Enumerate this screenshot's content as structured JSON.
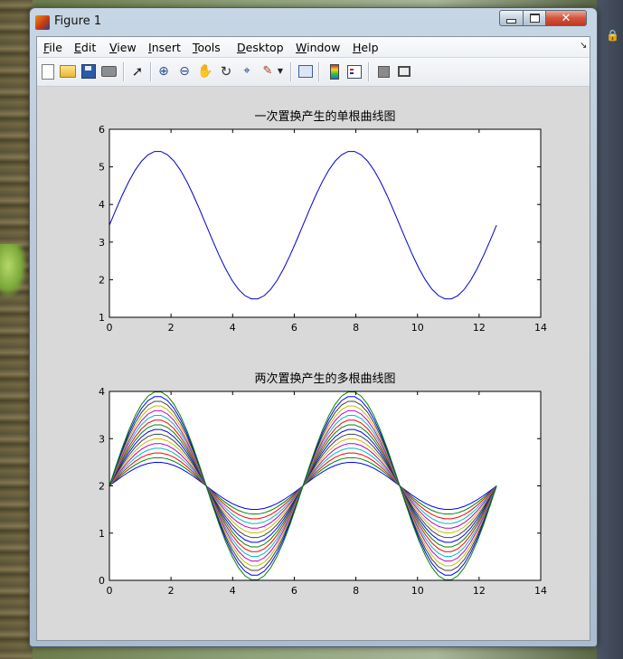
{
  "window": {
    "title": "Figure 1",
    "close_glyph": "✕"
  },
  "menu": {
    "items": [
      "File",
      "Edit",
      "View",
      "Insert",
      "Tools",
      "Desktop",
      "Window",
      "Help"
    ],
    "arrow_glyph": "↘"
  },
  "toolbar": {
    "icons": [
      "new-figure-icon",
      "open-file-icon",
      "save-icon",
      "print-icon",
      "edit-plot-arrow-icon",
      "zoom-in-icon",
      "zoom-out-icon",
      "pan-hand-icon",
      "rotate-3d-icon",
      "data-cursor-icon",
      "brush-icon",
      "brush-dropdown-icon",
      "link-plot-icon",
      "colorbar-icon",
      "legend-icon",
      "hide-plot-tools-icon",
      "show-plot-tools-icon"
    ]
  },
  "desktop": {
    "lock_glyph": "🔒"
  },
  "chart_data": [
    {
      "type": "line",
      "title": "一次置换产生的单根曲线图",
      "xlim": [
        0,
        14
      ],
      "ylim": [
        1,
        6
      ],
      "xticks": [
        0,
        2,
        4,
        6,
        8,
        10,
        12,
        14
      ],
      "yticks": [
        1,
        2,
        3,
        4,
        5,
        6
      ],
      "series": [
        {
          "color": "#0000cc",
          "x_range": [
            0,
            12.566
          ],
          "center": 3.45,
          "amplitude": 1.97
        }
      ]
    },
    {
      "type": "line",
      "title": "两次置换产生的多根曲线图",
      "xlim": [
        0,
        14
      ],
      "ylim": [
        0,
        4
      ],
      "xticks": [
        0,
        2,
        4,
        6,
        8,
        10,
        12,
        14
      ],
      "yticks": [
        0,
        1,
        2,
        3,
        4
      ],
      "series": [
        {
          "color": "#0000ff",
          "x_range": [
            0,
            12.566
          ],
          "center": 2,
          "amplitude": 0.5
        },
        {
          "color": "#008000",
          "x_range": [
            0,
            12.566
          ],
          "center": 2,
          "amplitude": 0.6
        },
        {
          "color": "#ff0000",
          "x_range": [
            0,
            12.566
          ],
          "center": 2,
          "amplitude": 0.7
        },
        {
          "color": "#00bfbf",
          "x_range": [
            0,
            12.566
          ],
          "center": 2,
          "amplitude": 0.8
        },
        {
          "color": "#bf00bf",
          "x_range": [
            0,
            12.566
          ],
          "center": 2,
          "amplitude": 0.9
        },
        {
          "color": "#bfbf00",
          "x_range": [
            0,
            12.566
          ],
          "center": 2,
          "amplitude": 1.0
        },
        {
          "color": "#404040",
          "x_range": [
            0,
            12.566
          ],
          "center": 2,
          "amplitude": 1.1
        },
        {
          "color": "#0000ff",
          "x_range": [
            0,
            12.566
          ],
          "center": 2,
          "amplitude": 1.2
        },
        {
          "color": "#008000",
          "x_range": [
            0,
            12.566
          ],
          "center": 2,
          "amplitude": 1.3
        },
        {
          "color": "#ff0000",
          "x_range": [
            0,
            12.566
          ],
          "center": 2,
          "amplitude": 1.4
        },
        {
          "color": "#00bfbf",
          "x_range": [
            0,
            12.566
          ],
          "center": 2,
          "amplitude": 1.5
        },
        {
          "color": "#bf00bf",
          "x_range": [
            0,
            12.566
          ],
          "center": 2,
          "amplitude": 1.6
        },
        {
          "color": "#bfbf00",
          "x_range": [
            0,
            12.566
          ],
          "center": 2,
          "amplitude": 1.7
        },
        {
          "color": "#404040",
          "x_range": [
            0,
            12.566
          ],
          "center": 2,
          "amplitude": 1.8
        },
        {
          "color": "#0000ff",
          "x_range": [
            0,
            12.566
          ],
          "center": 2,
          "amplitude": 1.9
        },
        {
          "color": "#008000",
          "x_range": [
            0,
            12.566
          ],
          "center": 2,
          "amplitude": 2.0
        }
      ]
    }
  ]
}
